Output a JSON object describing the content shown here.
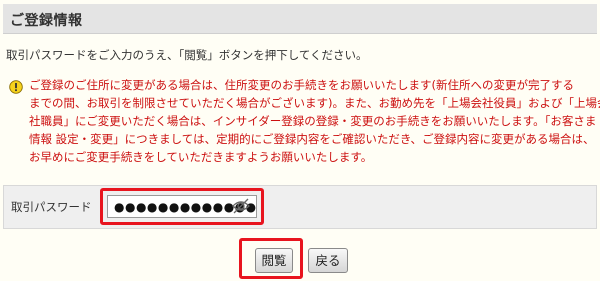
{
  "title": "ご登録情報",
  "instruction": "取引パスワードをご入力のうえ、「閲覧」ボタンを押下してください。",
  "notice": {
    "icon": "exclamation-icon",
    "color": "#cc1010",
    "lines": [
      "ご登録のご住所に変更がある場合は、住所変更のお手続きをお願いいたします(新住所への変更が完了する",
      "までの間、お取引を制限させていただく場合がございます)。また、お勤め先を「上場会社役員」および「上場会",
      "社職員」にご変更いただく場合は、インサイダー登録の登録・変更のお手続きをお願いいたします。「お客さま",
      "情報 設定・変更」につきましては、定期的にご登録内容をご確認いただき、ご登録内容に変更がある場合は、",
      "お早めにご変更手続きをしていただきますようお願いいたします。"
    ]
  },
  "form": {
    "password_label": "取引パスワード",
    "password_value": "●●●●●●●●●●●●●●",
    "toggle_icon": "eye-slash-icon"
  },
  "buttons": {
    "view_label": "閲覧",
    "back_label": "戻る"
  },
  "highlight_color": "#e8141e"
}
